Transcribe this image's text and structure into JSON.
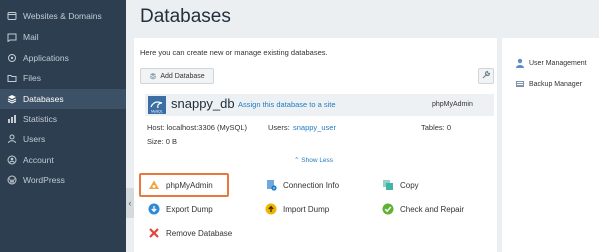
{
  "sidebar": {
    "items": [
      {
        "label": "Websites & Domains",
        "icon": "globe-icon"
      },
      {
        "label": "Mail",
        "icon": "mail-icon"
      },
      {
        "label": "Applications",
        "icon": "applications-icon"
      },
      {
        "label": "Files",
        "icon": "folder-icon"
      },
      {
        "label": "Databases",
        "icon": "database-icon",
        "active": true
      },
      {
        "label": "Statistics",
        "icon": "statistics-icon"
      },
      {
        "label": "Users",
        "icon": "user-icon"
      },
      {
        "label": "Account",
        "icon": "account-icon"
      },
      {
        "label": "WordPress",
        "icon": "wordpress-icon"
      }
    ],
    "collapse_glyph": "‹"
  },
  "page": {
    "title": "Databases",
    "intro": "Here you can create new or manage existing databases.",
    "add_db_label": "Add Database"
  },
  "db": {
    "name": "snappy_db",
    "logo_text": "MySQL",
    "assign_link": "Assign this database to a site",
    "phpmyadmin_link": "phpMyAdmin",
    "host": "Host: localhost:3306 (MySQL)",
    "users_label": "Users:",
    "users_value": "snappy_user",
    "tables": "Tables: 0",
    "size": "Size: 0 B",
    "show_less": "⌃ Show Less"
  },
  "actions": {
    "phpmyadmin": "phpMyAdmin",
    "connection_info": "Connection Info",
    "copy": "Copy",
    "export_dump": "Export Dump",
    "import_dump": "Import Dump",
    "check_repair": "Check and Repair",
    "remove_db": "Remove Database"
  },
  "side_panel": {
    "user_management": "User Management",
    "backup_manager": "Backup Manager"
  },
  "colors": {
    "sidebar_bg": "#2c3e50",
    "accent_link": "#1f7bc1",
    "highlight": "#e8793a"
  }
}
